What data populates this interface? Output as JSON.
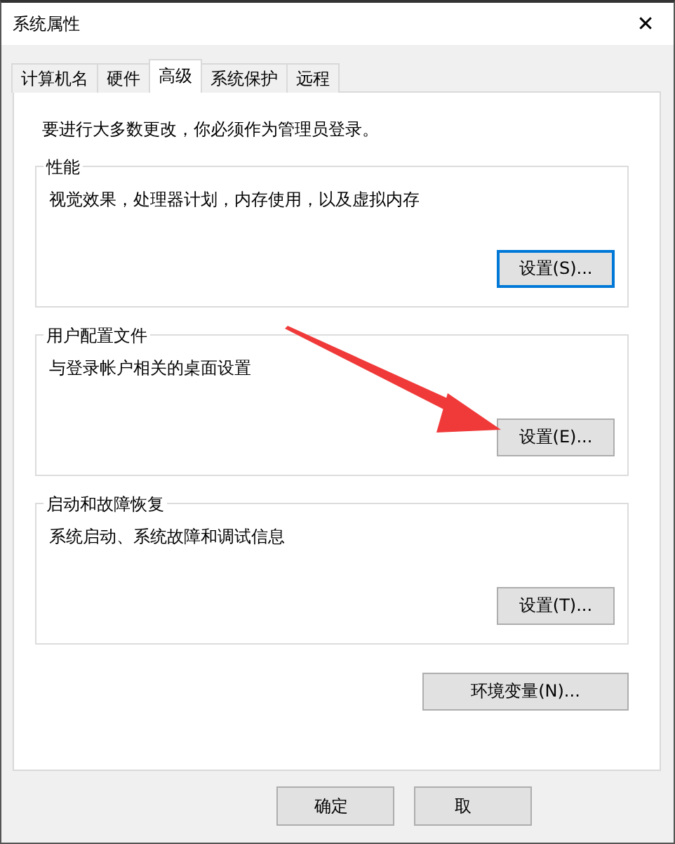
{
  "window": {
    "title": "系统属性",
    "close": "✕"
  },
  "tabs": [
    {
      "label": "计算机名",
      "selected": false
    },
    {
      "label": "硬件",
      "selected": false
    },
    {
      "label": "高级",
      "selected": true
    },
    {
      "label": "系统保护",
      "selected": false
    },
    {
      "label": "远程",
      "selected": false
    }
  ],
  "notice": "要进行大多数更改，你必须作为管理员登录。",
  "groups": [
    {
      "title": "性能",
      "description": "视觉效果，处理器计划，内存使用，以及虚拟内存",
      "button": {
        "label": "设置(S)...",
        "default": true
      }
    },
    {
      "title": "用户配置文件",
      "description": "与登录帐户相关的桌面设置",
      "button": {
        "label": "设置(E)...",
        "default": false
      }
    },
    {
      "title": "启动和故障恢复",
      "description": "系统启动、系统故障和调试信息",
      "button": {
        "label": "设置(T)...",
        "default": false
      }
    }
  ],
  "environment_button": "环境变量(N)...",
  "footer_buttons": [
    "确定",
    "取"
  ]
}
